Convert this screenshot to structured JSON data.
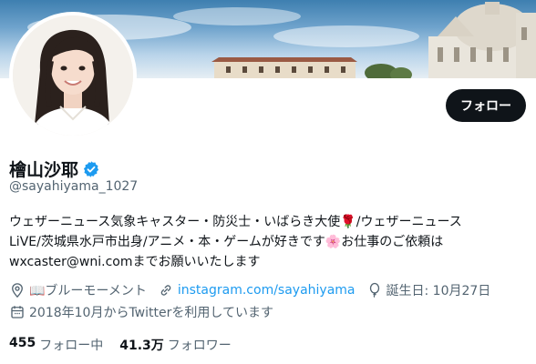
{
  "profile": {
    "display_name": "檜山沙耶",
    "handle": "@sayahiyama_1027",
    "bio": "ウェザーニュース気象キャスター・防災士・いばらき大使🌹/ウェザーニュース\nLiVE/茨城県水戸市出身/アニメ・本・ゲームが好きです🌸お仕事のご依頼は\nwxcaster@wni.comまでお願いいたします",
    "location": "📖ブルーモーメント",
    "website": "instagram.com/sayahiyama",
    "birthday": "誕生日: 10月27日",
    "joined": "2018年10月からTwitterを利用しています",
    "verified_color": "#1d9bf0"
  },
  "actions": {
    "follow_label": "フォロー"
  },
  "stats": {
    "following_count": "455",
    "following_label": "フォロー中",
    "followers_count": "41.3万",
    "followers_label": "フォロワー"
  },
  "icons": {
    "verified": "verified-badge-icon",
    "location": "location-pin-icon",
    "link": "link-icon",
    "birthday": "balloon-icon",
    "joined": "calendar-icon"
  }
}
